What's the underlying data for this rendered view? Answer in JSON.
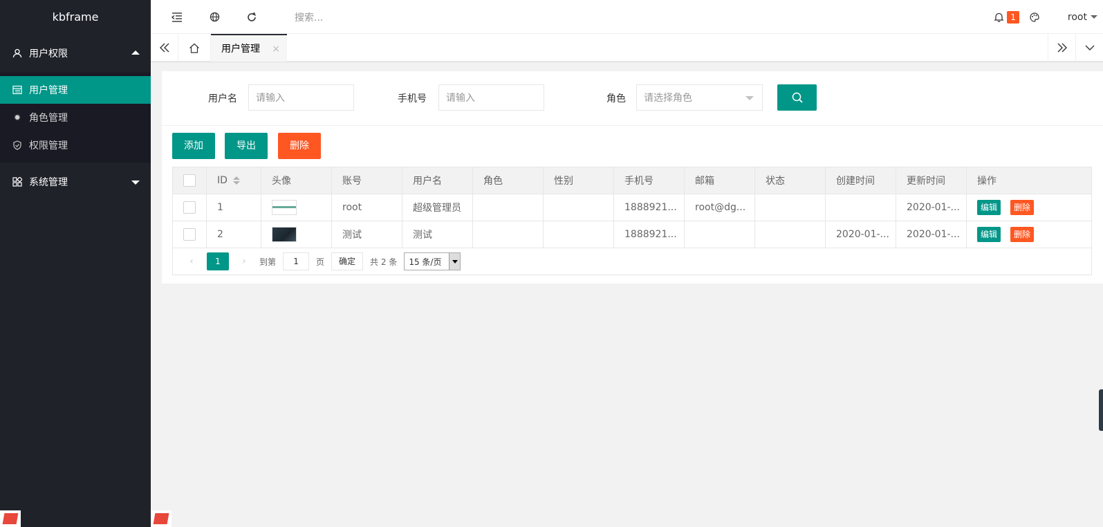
{
  "sidebar": {
    "logo": "kbframe",
    "groups": [
      {
        "label": "用户权限",
        "items": [
          {
            "label": "用户管理",
            "active": true
          },
          {
            "label": "角色管理",
            "active": false
          },
          {
            "label": "权限管理",
            "active": false
          }
        ]
      },
      {
        "label": "系统管理",
        "items": []
      }
    ]
  },
  "header": {
    "search_placeholder": "搜索...",
    "notification_count": "1",
    "user": "root"
  },
  "tabs": {
    "active": "用户管理",
    "close": "×"
  },
  "filters": {
    "username_label": "用户名",
    "username_placeholder": "请输入",
    "phone_label": "手机号",
    "phone_placeholder": "请输入",
    "role_label": "角色",
    "role_placeholder": "请选择角色"
  },
  "actions": {
    "add": "添加",
    "export": "导出",
    "delete": "删除"
  },
  "table": {
    "columns": [
      "ID",
      "头像",
      "账号",
      "用户名",
      "角色",
      "性别",
      "手机号",
      "邮箱",
      "状态",
      "创建时间",
      "更新时间",
      "操作"
    ],
    "rows": [
      {
        "id": "1",
        "account": "root",
        "username": "超级管理员",
        "role": "",
        "gender": "",
        "phone": "1888921...",
        "email": "root@dg...",
        "status": "",
        "created": "",
        "updated": "2020-01-..."
      },
      {
        "id": "2",
        "account": "测试",
        "username": "测试",
        "role": "",
        "gender": "",
        "phone": "1888921...",
        "email": "",
        "status": "",
        "created": "2020-01-...",
        "updated": "2020-01-..."
      }
    ],
    "row_edit": "编辑",
    "row_delete": "删除"
  },
  "pager": {
    "current": "1",
    "goto_label": "到第",
    "goto_value": "1",
    "page_unit": "页",
    "confirm": "确定",
    "total": "共 2 条",
    "page_size": "15 条/页"
  },
  "colors": {
    "primary": "#009688",
    "danger": "#ff5722",
    "sidebar": "#20222a"
  }
}
